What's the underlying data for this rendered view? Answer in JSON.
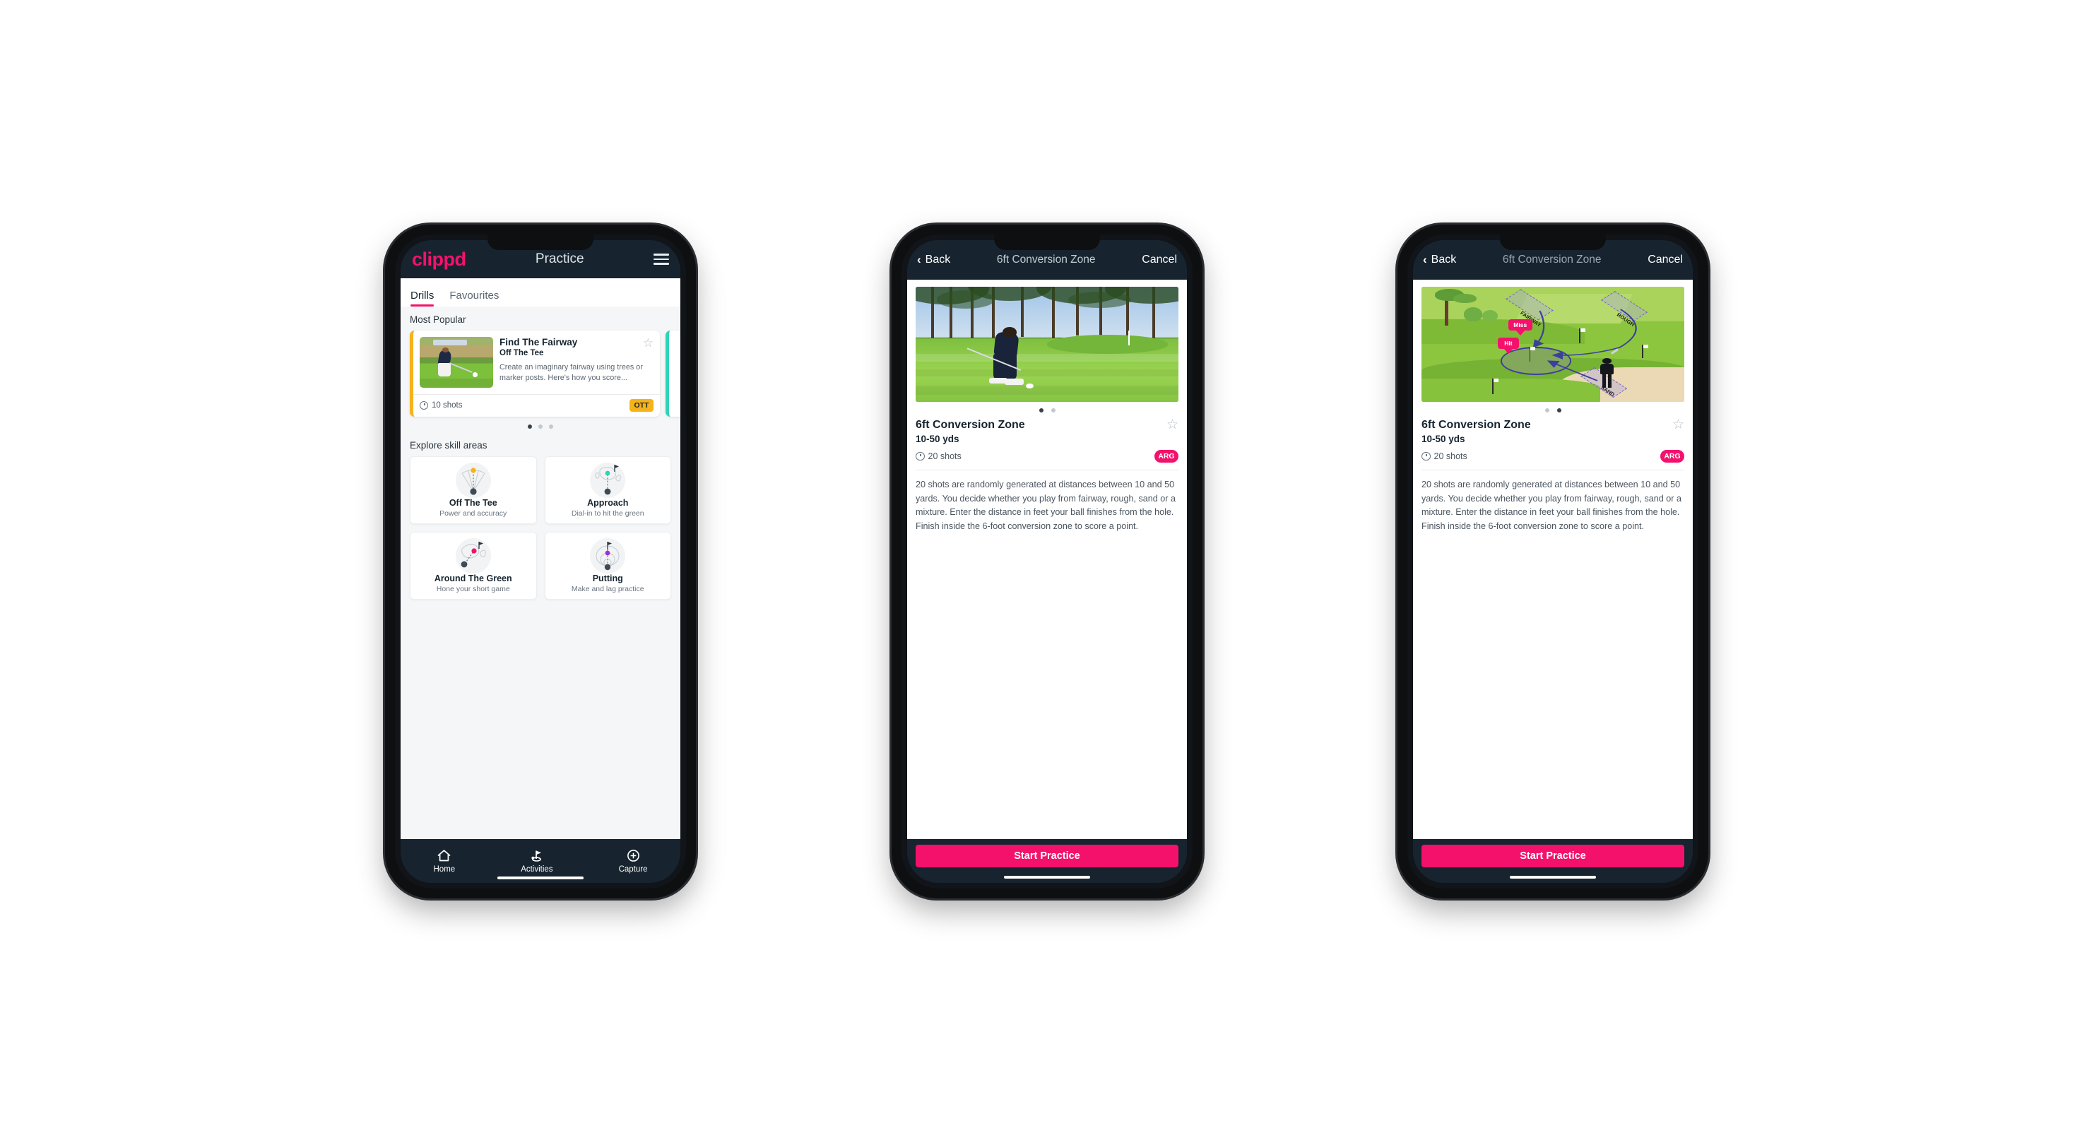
{
  "brand": "clippd",
  "phone1": {
    "appbar": {
      "title": "Practice",
      "menu_icon": "hamburger-menu-icon"
    },
    "tabs": [
      {
        "label": "Drills",
        "active": true
      },
      {
        "label": "Favourites",
        "active": false
      }
    ],
    "most_popular_label": "Most Popular",
    "drill_card": {
      "title": "Find The Fairway",
      "subtitle": "Off The Tee",
      "description": "Create an imaginary fairway using trees or marker posts. Here's how you score...",
      "shots": "10 shots",
      "badge": "OTT",
      "badge_color": "#f5b21a",
      "accent_color": "#f5b21a",
      "favourite_icon": "star-outline-icon"
    },
    "carousel_dots": {
      "count": 3,
      "active_index": 0
    },
    "explore_label": "Explore skill areas",
    "skill_areas": [
      {
        "name": "Off The Tee",
        "desc": "Power and accuracy",
        "icon": "tee-fan-icon",
        "dot_color": "#f5b21a"
      },
      {
        "name": "Approach",
        "desc": "Dial-in to hit the green",
        "icon": "approach-green-icon",
        "dot_color": "#2fd3b8"
      },
      {
        "name": "Around The Green",
        "desc": "Hone your short game",
        "icon": "chip-green-icon",
        "dot_color": "#f4116b"
      },
      {
        "name": "Putting",
        "desc": "Make and lag practice",
        "icon": "putting-rings-icon",
        "dot_color": "#9b30d9"
      }
    ],
    "tabbar": [
      {
        "label": "Home",
        "icon": "home-icon",
        "active": false
      },
      {
        "label": "Activities",
        "icon": "golf-flag-icon",
        "active": true
      },
      {
        "label": "Capture",
        "icon": "plus-circle-icon",
        "active": false
      }
    ]
  },
  "phone2": {
    "navbar": {
      "back": "Back",
      "title": "6ft Conversion Zone",
      "cancel": "Cancel",
      "back_icon": "chevron-left-icon"
    },
    "media_type": "photo-golfer-chipping",
    "carousel_dots": {
      "count": 2,
      "active_index": 0
    },
    "title": "6ft Conversion Zone",
    "subtitle": "10-50 yds",
    "shots": "20 shots",
    "badge": "ARG",
    "badge_color": "#f4116b",
    "favourite_icon": "star-outline-icon",
    "description": "20 shots are randomly generated at distances between 10 and 50 yards. You decide whether you play from fairway, rough, sand or a mixture. Enter the distance in feet your ball finishes from the hole. Finish inside the 6-foot conversion zone to score a point.",
    "cta": "Start Practice"
  },
  "phone3": {
    "navbar": {
      "back": "Back",
      "title": "6ft Conversion Zone",
      "cancel": "Cancel",
      "back_icon": "chevron-left-icon"
    },
    "media_type": "illustration-golf-hole-diagram",
    "illustration": {
      "zones": [
        "FAIRWAY",
        "ROUGH",
        "SAND"
      ],
      "callouts": [
        "Miss",
        "Hit"
      ],
      "callout_color": "#f4116b"
    },
    "carousel_dots": {
      "count": 2,
      "active_index": 1
    },
    "title": "6ft Conversion Zone",
    "subtitle": "10-50 yds",
    "shots": "20 shots",
    "badge": "ARG",
    "badge_color": "#f4116b",
    "favourite_icon": "star-outline-icon",
    "description": "20 shots are randomly generated at distances between 10 and 50 yards. You decide whether you play from fairway, rough, sand or a mixture. Enter the distance in feet your ball finishes from the hole. Finish inside the 6-foot conversion zone to score a point.",
    "cta": "Start Practice"
  },
  "colors": {
    "brand_pink": "#f4116b",
    "dark_navy": "#17242f",
    "amber": "#f5b21a",
    "teal": "#2fd3b8",
    "purple": "#9b30d9"
  }
}
